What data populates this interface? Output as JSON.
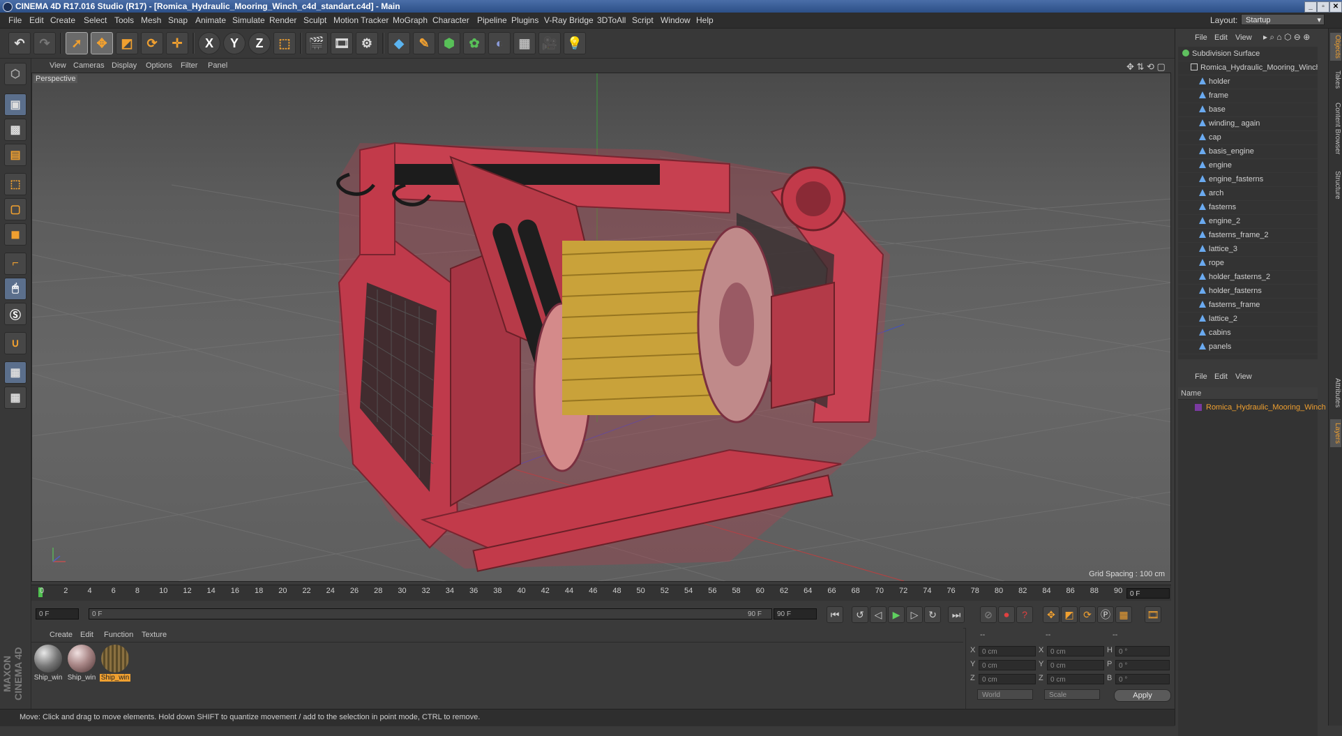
{
  "window": {
    "title": "CINEMA 4D R17.016 Studio (R17) - [Romica_Hydraulic_Mooring_Winch_c4d_standart.c4d] - Main"
  },
  "menubar": {
    "items": [
      "File",
      "Edit",
      "Create",
      "Select",
      "Tools",
      "Mesh",
      "Snap",
      "Animate",
      "Simulate",
      "Render",
      "Sculpt",
      "Motion Tracker",
      "MoGraph",
      "Character",
      "Pipeline",
      "Plugins",
      "V-Ray Bridge",
      "3DToAll",
      "Script",
      "Window",
      "Help"
    ],
    "layout_label": "Layout:",
    "layout_value": "Startup"
  },
  "toolbar": {
    "buttons": [
      "undo-icon",
      "redo-icon",
      "live-selection-icon",
      "move-icon",
      "scale-icon",
      "rotate-icon",
      "recent-tool-icon",
      "x-axis-icon",
      "y-axis-icon",
      "z-axis-icon",
      "coordinate-system-icon",
      "render-view-icon",
      "render-picture-viewer-icon",
      "edit-render-settings-icon",
      "cube-icon",
      "pen-icon",
      "subdivision-icon",
      "mograph-cloner-icon",
      "deformer-icon",
      "floor-icon",
      "camera-icon",
      "light-icon"
    ],
    "axis_labels": {
      "x": "X",
      "y": "Y",
      "z": "Z"
    }
  },
  "viewport": {
    "menu": [
      "View",
      "Cameras",
      "Display",
      "Options",
      "Filter",
      "Panel"
    ],
    "camera_label": "Perspective",
    "grid_spacing": "Grid Spacing : 100 cm"
  },
  "timeline": {
    "ticks": [
      "0",
      "2",
      "4",
      "6",
      "8",
      "10",
      "12",
      "14",
      "16",
      "18",
      "20",
      "22",
      "24",
      "26",
      "28",
      "30",
      "32",
      "34",
      "36",
      "38",
      "40",
      "42",
      "44",
      "46",
      "48",
      "50",
      "52",
      "54",
      "56",
      "58",
      "60",
      "62",
      "64",
      "66",
      "68",
      "70",
      "72",
      "74",
      "76",
      "78",
      "80",
      "82",
      "84",
      "86",
      "88",
      "90"
    ],
    "current_frame": "0 F",
    "start_field": "0 F",
    "slider_start": "0 F",
    "slider_end": "90 F",
    "end_field": "90 F"
  },
  "materials": {
    "menu": [
      "Create",
      "Edit",
      "Function",
      "Texture"
    ],
    "items": [
      {
        "label": "Ship_win",
        "selected": false
      },
      {
        "label": "Ship_win",
        "selected": false
      },
      {
        "label": "Ship_win",
        "selected": true
      }
    ]
  },
  "coordinates": {
    "header": [
      "--",
      "--",
      "--"
    ],
    "rows": [
      {
        "a": "X",
        "a_val": "0 cm",
        "b": "X",
        "b_val": "0 cm",
        "c": "H",
        "c_val": "0 °"
      },
      {
        "a": "Y",
        "a_val": "0 cm",
        "b": "Y",
        "b_val": "0 cm",
        "c": "P",
        "c_val": "0 °"
      },
      {
        "a": "Z",
        "a_val": "0 cm",
        "b": "Z",
        "b_val": "0 cm",
        "c": "B",
        "c_val": "0 °"
      }
    ],
    "mode_1": "World",
    "mode_2": "Scale",
    "apply": "Apply"
  },
  "status": {
    "text": "Move: Click and drag to move elements. Hold down SHIFT to quantize movement / add to the selection in point mode, CTRL to remove."
  },
  "object_manager": {
    "menu": [
      "File",
      "Edit",
      "View"
    ],
    "root": "Subdivision Surface",
    "group": "Romica_Hydraulic_Mooring_Winch",
    "children": [
      "holder",
      "frame",
      "base",
      "winding_ again",
      "cap",
      "basis_engine",
      "engine",
      "engine_fasterns",
      "arch",
      "fasterns",
      "engine_2",
      "fasterns_frame_2",
      "lattice_3",
      "rope",
      "holder_fasterns_2",
      "holder_fasterns",
      "fasterns_frame",
      "lattice_2",
      "cabins",
      "panels"
    ]
  },
  "layer_manager": {
    "menu": [
      "File",
      "Edit",
      "View"
    ],
    "column_name": "Name",
    "layer": "Romica_Hydraulic_Mooring_Winch"
  },
  "side_tabs": {
    "top": [
      "Objects",
      "Takes",
      "Content Browser",
      "Structure"
    ],
    "bottom": [
      "Attributes",
      "Layers"
    ]
  },
  "brand": {
    "text": "MAXON CINEMA 4D"
  },
  "colors": {
    "accent": "#f0a030",
    "winch_red": "#c23a4a",
    "rope": "#c8a23a"
  }
}
